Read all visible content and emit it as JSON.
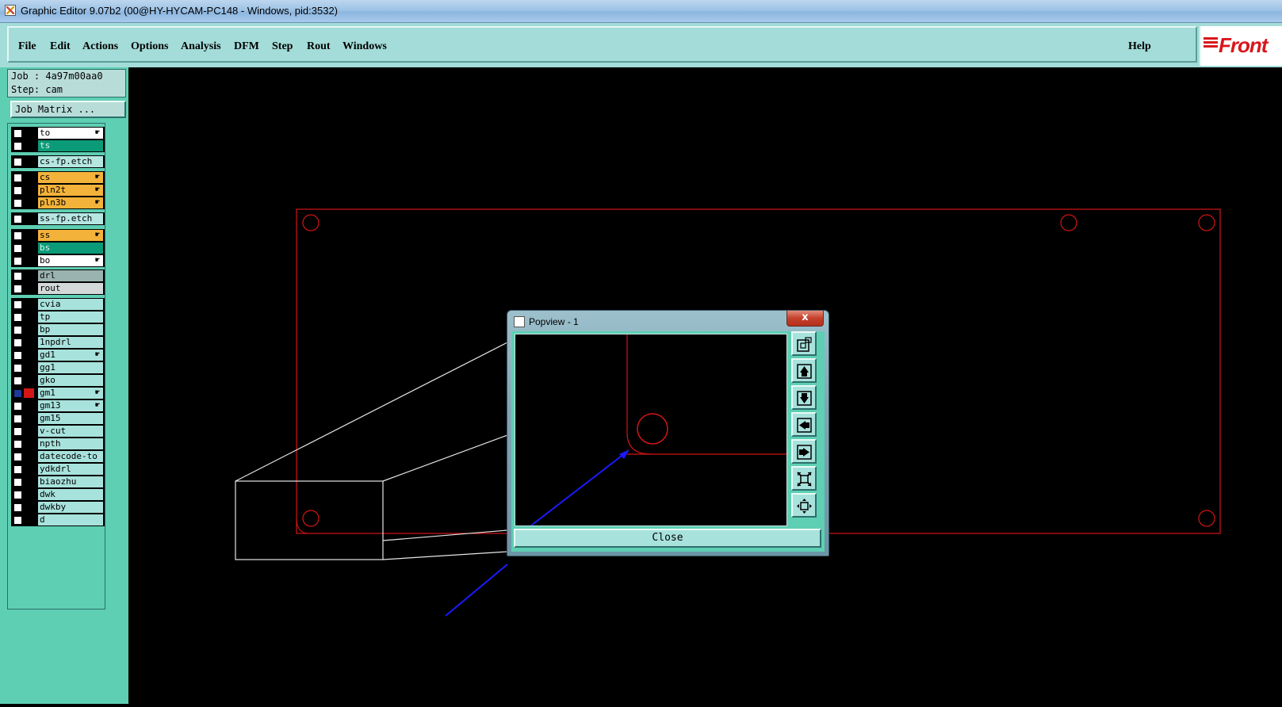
{
  "window": {
    "title": "Graphic Editor 9.07b2 (00@HY-HYCAM-PC148 - Windows, pid:3532)"
  },
  "menu": {
    "file": "File",
    "edit": "Edit",
    "actions": "Actions",
    "options": "Options",
    "analysis": "Analysis",
    "dfm": "DFM",
    "step": "Step",
    "rout": "Rout",
    "windows": "Windows",
    "help": "Help"
  },
  "logo": {
    "text": "Front"
  },
  "job": {
    "job_line": "Job : 4a97m00aa0",
    "step_line": "Step: cam",
    "matrix_button": "Job Matrix ..."
  },
  "layers": [
    {
      "name": "to",
      "color": "#ffffff",
      "mark": "hand-icon"
    },
    {
      "name": "ts",
      "color": "#0c9b78"
    },
    {
      "name": "cs-fp.etch",
      "color": "#b6e6e2"
    },
    {
      "name": "cs",
      "color": "#f3b23a",
      "mark": "hand-icon"
    },
    {
      "name": "pln2t",
      "color": "#f3b23a",
      "mark": "hand-icon"
    },
    {
      "name": "pln3b",
      "color": "#f3b23a",
      "mark": "hand-icon"
    },
    {
      "name": "ss-fp.etch",
      "color": "#b6e6e2"
    },
    {
      "name": "ss",
      "color": "#f3b23a",
      "mark": "hand-icon"
    },
    {
      "name": "bs",
      "color": "#0c9b78"
    },
    {
      "name": "bo",
      "color": "#ffffff",
      "mark": "hand-icon"
    },
    {
      "name": "drl",
      "color": "#9ab2b0"
    },
    {
      "name": "rout",
      "color": "#d4d8d8"
    },
    {
      "name": "cvia",
      "color": "#a8e2dc"
    },
    {
      "name": "tp",
      "color": "#a8e2dc"
    },
    {
      "name": "bp",
      "color": "#a8e2dc"
    },
    {
      "name": "1npdrl",
      "color": "#a8e2dc"
    },
    {
      "name": "gd1",
      "color": "#a8e2dc",
      "mark": "hand-icon"
    },
    {
      "name": "gg1",
      "color": "#a8e2dc"
    },
    {
      "name": "gko",
      "color": "#a8e2dc"
    },
    {
      "name": "gm1",
      "color": "#a8e2dc",
      "mark": "hand-icon",
      "active": true,
      "swatch": "#d31616"
    },
    {
      "name": "gm13",
      "color": "#a8e2dc",
      "mark": "hand-icon"
    },
    {
      "name": "gm15",
      "color": "#a8e2dc"
    },
    {
      "name": "v-cut",
      "color": "#a8e2dc"
    },
    {
      "name": "npth",
      "color": "#a8e2dc"
    },
    {
      "name": "datecode-to",
      "color": "#a8e2dc"
    },
    {
      "name": "ydkdrl",
      "color": "#a8e2dc"
    },
    {
      "name": "biaozhu",
      "color": "#a8e2dc"
    },
    {
      "name": "dwk",
      "color": "#a8e2dc"
    },
    {
      "name": "dwkby",
      "color": "#a8e2dc"
    },
    {
      "name": "d",
      "color": "#a8e2dc"
    }
  ],
  "popview": {
    "title": "Popview - 1",
    "close_x": "x",
    "close_button": "Close",
    "tools": [
      "zoom-home-icon",
      "pan-up-icon",
      "pan-down-icon",
      "pan-left-icon",
      "pan-right-icon",
      "zoom-in-icon",
      "zoom-out-icon"
    ]
  },
  "colors": {
    "board_outline": "#d41515",
    "menu_bg": "#a3dcd8",
    "panel_bg": "#5ecfb3",
    "pointer_line": "#1a1aff",
    "logo": "#d8171c"
  }
}
